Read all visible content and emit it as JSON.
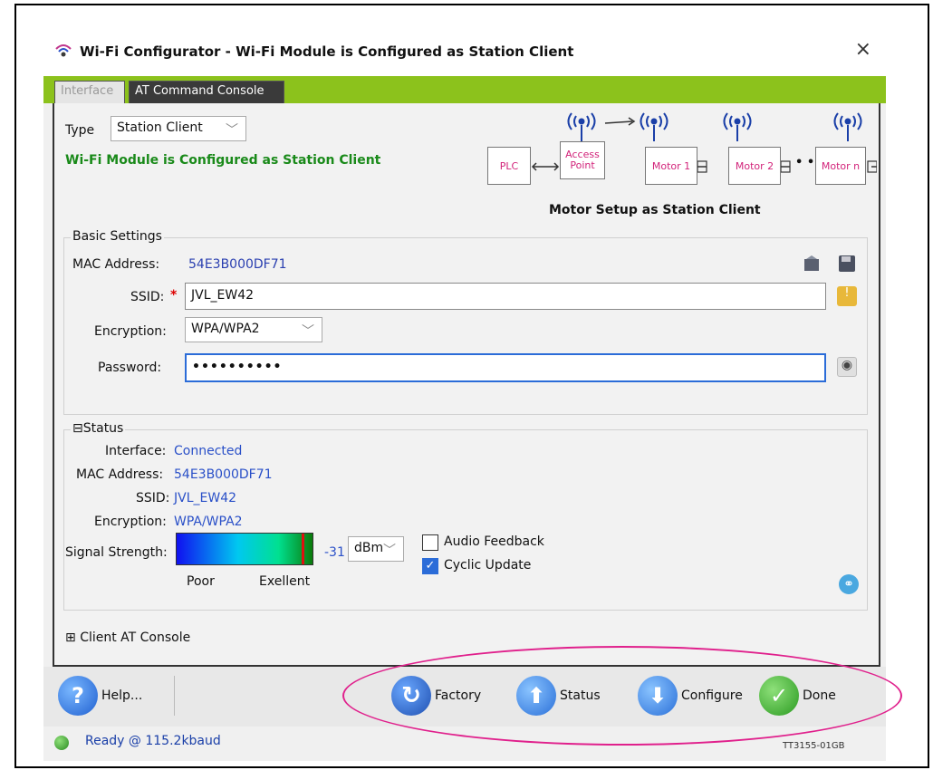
{
  "window": {
    "title": "Wi-Fi Configurator - Wi-Fi Module is Configured as Station Client",
    "close_glyph": "×"
  },
  "tabs": [
    {
      "label": "Interface"
    },
    {
      "label": "AT Command Console"
    }
  ],
  "type_row": {
    "label": "Type",
    "value": "Station Client"
  },
  "configured_message": "Wi-Fi Module is Configured as Station Client",
  "diagram": {
    "plc": "PLC",
    "access_point": "Access Point",
    "motor1": "Motor 1",
    "motor2": "Motor 2",
    "motorn": "Motor n",
    "dots": "• • • •",
    "caption": "Motor Setup as Station Client"
  },
  "basic_settings": {
    "title": "Basic Settings",
    "mac_label": "MAC Address:",
    "mac_value": "54E3B000DF71",
    "ssid_label": "SSID:",
    "required_marker": "*",
    "ssid_value": "JVL_EW42",
    "encryption_label": "Encryption:",
    "encryption_value": "WPA/WPA2",
    "password_label": "Password:",
    "password_value": "••••••••••"
  },
  "status": {
    "title": "Status",
    "collapse_glyph": "⊟",
    "interface_label": "Interface:",
    "interface_value": "Connected",
    "mac_label": "MAC Address:",
    "mac_value": "54E3B000DF71",
    "ssid_label": "SSID:",
    "ssid_value": "JVL_EW42",
    "encryption_label": "Encryption:",
    "encryption_value": "WPA/WPA2",
    "signal_label": "Signal Strength:",
    "signal_value": "-31",
    "signal_unit": "dBm",
    "signal_level": 0.92,
    "poor_label": "Poor",
    "excellent_label": "Exellent",
    "audio_feedback_label": "Audio Feedback",
    "audio_feedback_checked": false,
    "cyclic_update_label": "Cyclic Update",
    "cyclic_update_checked": true
  },
  "client_console": {
    "expand_glyph": "⊞",
    "label": "Client AT Console"
  },
  "buttons": {
    "help": "Help...",
    "factory": "Factory",
    "status": "Status",
    "configure": "Configure",
    "done": "Done"
  },
  "statusbar": {
    "text": "Ready @ 115.2kbaud",
    "figure_code": "TT3155-01GB"
  },
  "colors": {
    "accent_green": "#8cc21c",
    "annotation_pink": "#e0208c",
    "link_blue": "#2a50c8"
  }
}
